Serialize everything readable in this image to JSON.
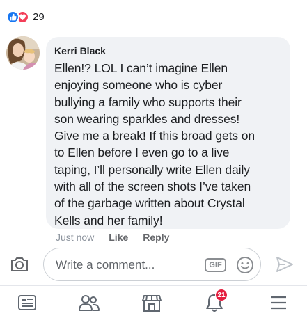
{
  "post": {
    "reaction_count": "29",
    "reaction_icons": [
      "like-icon",
      "love-icon"
    ]
  },
  "comment": {
    "author": "Kerri Black",
    "lines": [
      "Ellen!? LOL I can’t imagine Ellen",
      "enjoying someone who is cyber",
      "bullying a family who supports their",
      "son wearing sparkles and dresses!",
      "Give me a break! If this broad gets on",
      "to Ellen before I even go to a live",
      "taping, I’ll personally write Ellen daily",
      "with all of the screen shots I’ve taken",
      "of the garbage written about Crystal",
      "Kells and her family!"
    ],
    "timestamp": "Just now",
    "like_label": "Like",
    "reply_label": "Reply"
  },
  "composer": {
    "placeholder": "Write a comment...",
    "gif_label": "GIF"
  },
  "nav": {
    "items": [
      "news-feed-icon",
      "friends-icon",
      "marketplace-icon",
      "notifications-icon",
      "menu-icon"
    ],
    "notification_badge": "21"
  },
  "colors": {
    "like": "#1877f2",
    "love": "#f33e58",
    "badge": "#e41e3f",
    "bubble": "#f0f2f5"
  }
}
